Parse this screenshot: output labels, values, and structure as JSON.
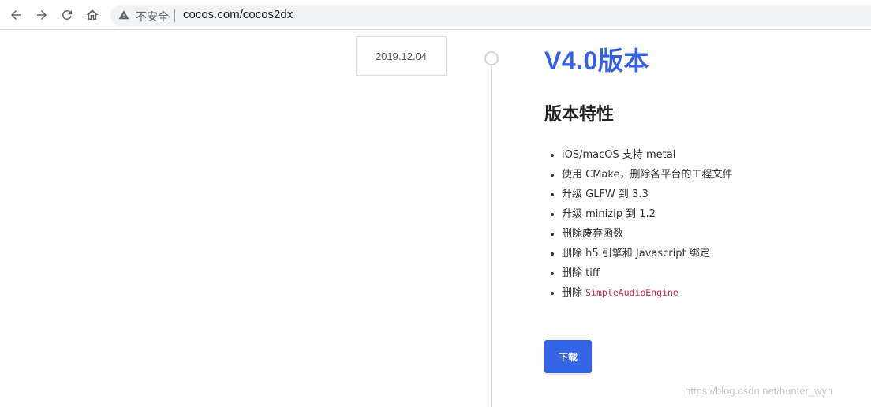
{
  "browser": {
    "security_label": "不安全",
    "url": "cocos.com/cocos2dx"
  },
  "release": {
    "date": "2019.12.04",
    "title": "V4.0版本",
    "features_heading": "版本特性",
    "features": [
      "iOS/macOS 支持 metal",
      "使用 CMake，删除各平台的工程文件",
      "升级 GLFW 到 3.3",
      "升级 minizip 到 1.2",
      "删除废弃函数",
      "删除 h5 引擎和 Javascript 绑定",
      "删除 tiff"
    ],
    "last_feature_prefix": "删除 ",
    "last_feature_code": "SimpleAudioEngine",
    "download_label": "下载"
  },
  "watermark": "https://blog.csdn.net/hunter_wyh",
  "colors": {
    "accent": "#3660e0",
    "button": "#3465e6",
    "code": "#c7254e"
  }
}
